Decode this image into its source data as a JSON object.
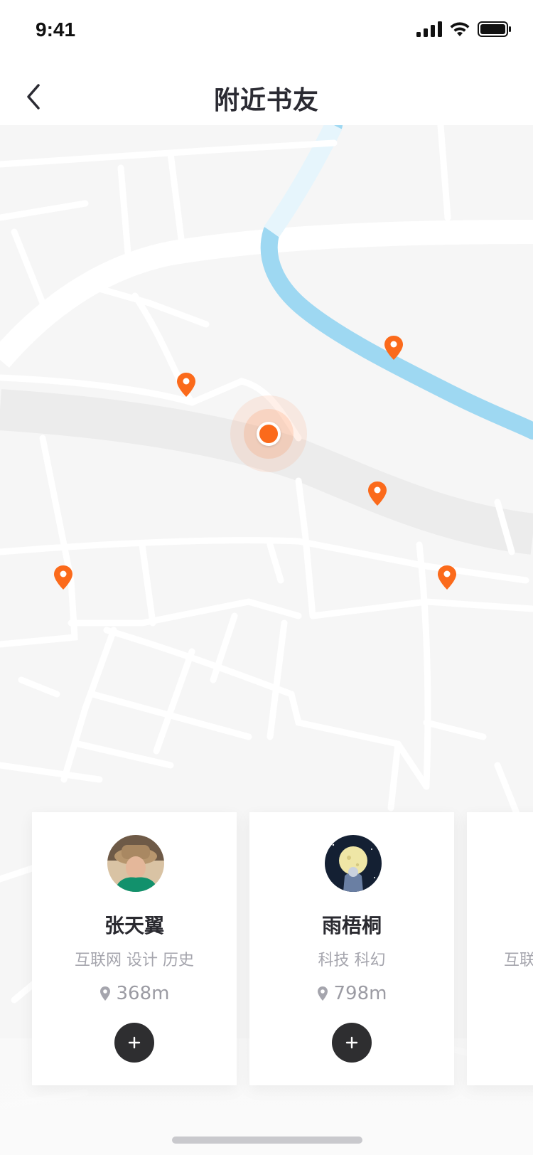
{
  "status": {
    "time": "9:41"
  },
  "nav": {
    "title": "附近书友"
  },
  "colors": {
    "accent": "#fb6a1b",
    "river": "#9ed8f2",
    "button": "#2e2e30"
  },
  "map": {
    "me_label": "current-location",
    "pins": [
      "pin-1",
      "pin-2",
      "pin-3",
      "pin-4",
      "pin-5"
    ]
  },
  "users": [
    {
      "name": "张天翼",
      "tags": "互联网 设计 历史",
      "distance": "368m",
      "avatar": "portrait-hat"
    },
    {
      "name": "雨梧桐",
      "tags": "科技 科幻",
      "distance": "798m",
      "avatar": "astronaut-moon"
    },
    {
      "name": "",
      "tags": "互联",
      "distance": "",
      "avatar": ""
    }
  ]
}
